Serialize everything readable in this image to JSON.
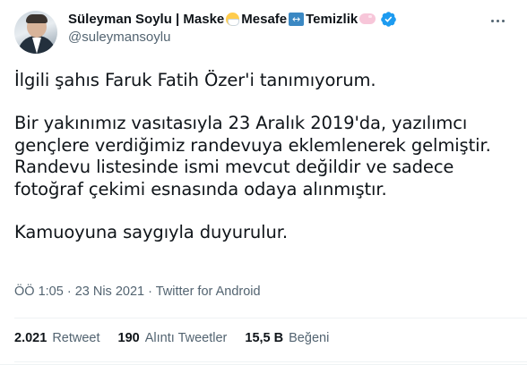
{
  "author": {
    "name_parts": [
      "Süleyman Soylu | Maske",
      "Mesafe",
      "Temizlik"
    ],
    "emojis": [
      "mask-emoji",
      "left-right-arrow-emoji",
      "soap-emoji"
    ],
    "handle": "@suleymansoylu",
    "verified_color": "#1d9bf0"
  },
  "tweet": {
    "paragraphs": [
      [
        "İlgili şahıs Faruk Fatih Özer'i tanımıyorum."
      ],
      [
        "Bir yakınımız vasıtasıyla 23 Aralık 2019'da, yazılımcı",
        "gençlere verdiğimiz randevuya eklemlenerek gelmiştir.",
        "Randevu listesinde ismi mevcut değildir ve sadece",
        "fotoğraf çekimi esnasında odaya alınmıştır."
      ],
      [
        "Kamuoyuna saygıyla duyurulur."
      ]
    ],
    "meta": "ÖÖ 1:05 · 23 Nis 2021 · Twitter for Android"
  },
  "stats": {
    "retweets": {
      "count": "2.021",
      "label": "Retweet"
    },
    "quotes": {
      "count": "190",
      "label": "Alıntı Tweetler"
    },
    "likes": {
      "count": "15,5 B",
      "label": "Beğeni"
    }
  },
  "icons": {
    "more": "more-options-icon",
    "verified": "verified-badge-icon"
  }
}
